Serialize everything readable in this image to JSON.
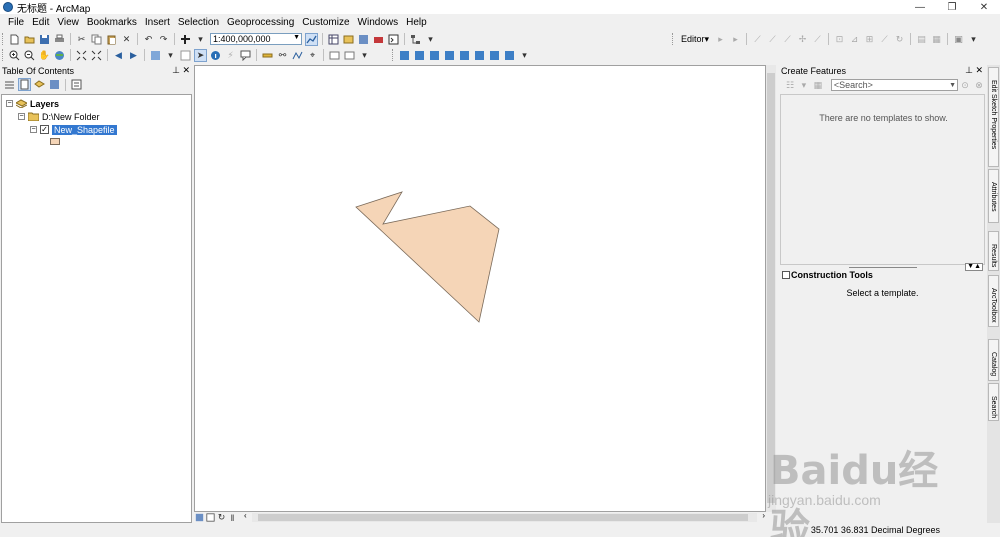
{
  "window": {
    "title": "无标题 - ArcMap",
    "controls": [
      "—",
      "❐",
      "✕"
    ]
  },
  "menu": [
    "File",
    "Edit",
    "View",
    "Bookmarks",
    "Insert",
    "Selection",
    "Geoprocessing",
    "Customize",
    "Windows",
    "Help"
  ],
  "toolbar": {
    "scale": "1:400,000,000",
    "editor_label": "Editor▾"
  },
  "toc": {
    "title": "Table Of Contents",
    "root": "Layers",
    "folder": "D:\\New Folder",
    "layer": "New_Shapefile",
    "layer_checked": true,
    "symbol_color": "#f5d5b7"
  },
  "map": {
    "polygon_fill": "#f5d5b7",
    "polygon_stroke": "#7a6a5a"
  },
  "create_features": {
    "title": "Create Features",
    "search_placeholder": "<Search>",
    "empty_message": "There are no templates to show."
  },
  "construction_tools": {
    "title": "Construction Tools",
    "message": "Select a template."
  },
  "side_tabs": [
    "Edit Sketch Properties",
    "Attributes",
    "Results",
    "ArcToolbox",
    "Catalog",
    "Search"
  ],
  "status": {
    "coordinates": "35.701  36.831 Decimal Degrees"
  },
  "watermark": {
    "brand": "Baidu经验",
    "url": "jingyan.baidu.com"
  }
}
